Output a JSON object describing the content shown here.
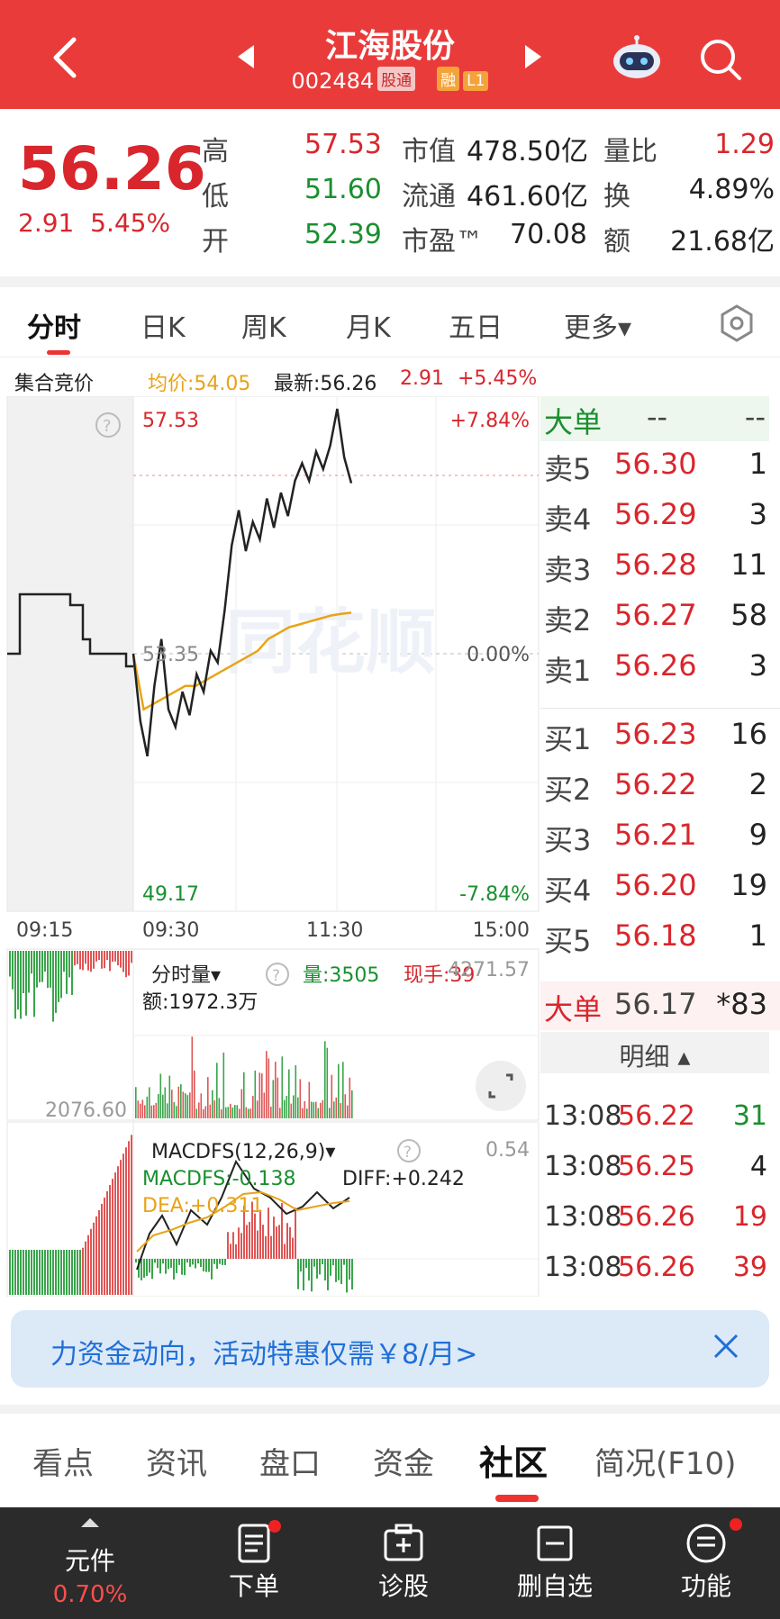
{
  "header": {
    "stock_name": "江海股份",
    "stock_code": "002484",
    "tag_connect": "股通",
    "tag_margin": "融",
    "tag_level": "L1"
  },
  "quote": {
    "price": "56.26",
    "change": "2.91",
    "change_pct": "5.45%",
    "high_label": "高",
    "high": "57.53",
    "low_label": "低",
    "low": "51.60",
    "open_label": "开",
    "open": "52.39",
    "mcap_label": "市值",
    "mcap": "478.50亿",
    "float_label": "流通",
    "float": "461.60亿",
    "pe_label": "市盈™",
    "pe": "70.08",
    "volratio_label": "量比",
    "volratio": "1.29",
    "turnover_label": "换",
    "turnover": "4.89%",
    "amount_label": "额",
    "amount": "21.68亿"
  },
  "tabs": [
    "分时",
    "日K",
    "周K",
    "月K",
    "五日",
    "更多▾"
  ],
  "info": {
    "auction": "集合竞价",
    "avg": "均价:54.05",
    "latest": "最新:56.26",
    "chg": "2.91",
    "pct": "+5.45%"
  },
  "chart": {
    "price_high": "57.53",
    "price_mid": "53.35",
    "price_low": "49.17",
    "pct_high": "+7.84%",
    "pct_mid": "0.00%",
    "pct_low": "-7.84%",
    "t0": "09:15",
    "t1": "09:30",
    "t2": "11:30",
    "t3": "15:00",
    "vol_label": "分时量▾",
    "vol_value": "量:3505",
    "hand": "现手:39",
    "vol_max": "4271.57",
    "amt": "额:1972.3万",
    "auction_vol": "2076.60",
    "macd_title": "MACDFS(12,26,9)▾",
    "macd_val": "MACDFS:-0.138",
    "diff": "DIFF:+0.242",
    "dea": "DEA:+0.311",
    "macd_max": "0.54"
  },
  "chart_data": {
    "type": "line",
    "title": "",
    "xlabel": "",
    "ylabel": "",
    "x_ticks": [
      "09:15",
      "09:30",
      "11:30",
      "15:00"
    ],
    "ylim": [
      49.17,
      57.53
    ],
    "prev_close": 53.35,
    "series": [
      {
        "name": "",
        "values": [
          53.35,
          52.2,
          51.6,
          52.8,
          53.6,
          52.4,
          52.1,
          52.7,
          52.3,
          53.0,
          52.7,
          53.4,
          53.2,
          54.1,
          55.2,
          55.8,
          55.1,
          55.6,
          55.3,
          56.0,
          55.5,
          56.1,
          55.7,
          56.3,
          56.6,
          56.3,
          56.8,
          56.5,
          56.9,
          57.53,
          56.7,
          56.26
        ]
      },
      {
        "name": "",
        "values": [
          53.35,
          52.4,
          52.5,
          52.6,
          52.7,
          52.8,
          52.8,
          52.9,
          53.0,
          53.1,
          53.2,
          53.3,
          53.4,
          53.6,
          53.7,
          53.8,
          53.85,
          53.9,
          53.95,
          54.0,
          54.03,
          54.05
        ]
      }
    ]
  },
  "book": {
    "dadan_label": "大单",
    "dadan_a": "--",
    "dadan_b": "--",
    "sells": [
      {
        "label": "卖5",
        "price": "56.30",
        "vol": "1"
      },
      {
        "label": "卖4",
        "price": "56.29",
        "vol": "3"
      },
      {
        "label": "卖3",
        "price": "56.28",
        "vol": "11"
      },
      {
        "label": "卖2",
        "price": "56.27",
        "vol": "58"
      },
      {
        "label": "卖1",
        "price": "56.26",
        "vol": "3"
      }
    ],
    "buys": [
      {
        "label": "买1",
        "price": "56.23",
        "vol": "16"
      },
      {
        "label": "买2",
        "price": "56.22",
        "vol": "2"
      },
      {
        "label": "买3",
        "price": "56.21",
        "vol": "9"
      },
      {
        "label": "买4",
        "price": "56.20",
        "vol": "19"
      },
      {
        "label": "买5",
        "price": "56.18",
        "vol": "1"
      }
    ],
    "big_label": "大单",
    "big_price": "56.17",
    "big_vol": "*83",
    "detail_label": "明细 ▴",
    "ticks": [
      {
        "time": "13:08",
        "price": "56.22",
        "vol": "31",
        "color": "#1a8f2f"
      },
      {
        "time": "13:08",
        "price": "56.25",
        "vol": "4",
        "color": "#222222"
      },
      {
        "time": "13:08",
        "price": "56.26",
        "vol": "19",
        "color": "#d8262c"
      },
      {
        "time": "13:08",
        "price": "56.26",
        "vol": "39",
        "color": "#d8262c"
      }
    ]
  },
  "banner": {
    "text": "力资金动向，活动特惠仅需￥8/月>"
  },
  "subtabs": [
    "看点",
    "资讯",
    "盘口",
    "资金",
    "社区",
    "简况(F10)"
  ],
  "bottom": [
    {
      "label": "元件",
      "extra": "0.70%"
    },
    {
      "label": "下单"
    },
    {
      "label": "诊股"
    },
    {
      "label": "删自选"
    },
    {
      "label": "功能"
    }
  ],
  "colors": {
    "brand": "#ea3b3b",
    "up": "#d8262c",
    "down": "#1a8f2f",
    "avg_line": "#e8a317"
  }
}
